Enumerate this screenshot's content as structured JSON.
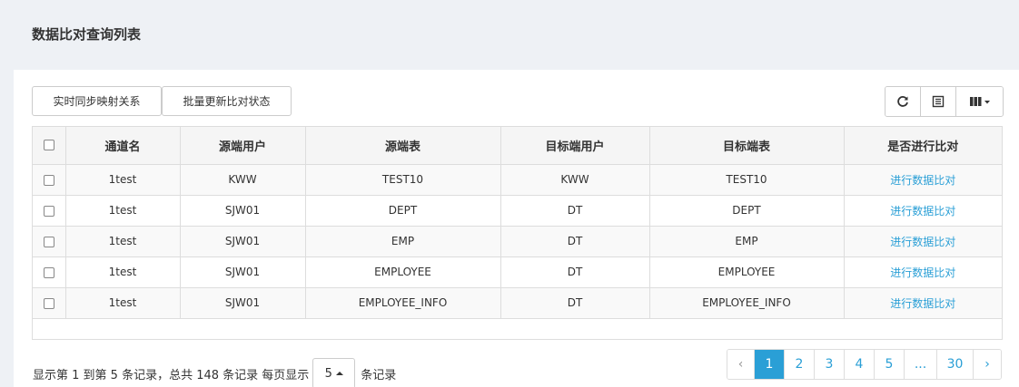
{
  "page": {
    "title": "数据比对查询列表"
  },
  "toolbar": {
    "sync_label": "实时同步映射关系",
    "batch_label": "批量更新比对状态",
    "refresh_icon": "refresh-icon",
    "list_icon": "list-icon",
    "columns_icon": "columns-icon"
  },
  "table": {
    "headers": [
      "通道名",
      "源端用户",
      "源端表",
      "目标端用户",
      "目标端表",
      "是否进行比对"
    ],
    "rows": [
      {
        "channel": "1test",
        "src_user": "KWW",
        "src_table": "TEST10",
        "dst_user": "KWW",
        "dst_table": "TEST10",
        "action": "进行数据比对"
      },
      {
        "channel": "1test",
        "src_user": "SJW01",
        "src_table": "DEPT",
        "dst_user": "DT",
        "dst_table": "DEPT",
        "action": "进行数据比对"
      },
      {
        "channel": "1test",
        "src_user": "SJW01",
        "src_table": "EMP",
        "dst_user": "DT",
        "dst_table": "EMP",
        "action": "进行数据比对"
      },
      {
        "channel": "1test",
        "src_user": "SJW01",
        "src_table": "EMPLOYEE",
        "dst_user": "DT",
        "dst_table": "EMPLOYEE",
        "action": "进行数据比对"
      },
      {
        "channel": "1test",
        "src_user": "SJW01",
        "src_table": "EMPLOYEE_INFO",
        "dst_user": "DT",
        "dst_table": "EMPLOYEE_INFO",
        "action": "进行数据比对"
      }
    ]
  },
  "footer": {
    "info_prefix": "显示第 1 到第 5 条记录，总共 148 条记录 每页显示",
    "page_size": "5",
    "info_suffix": "条记录"
  },
  "pagination": {
    "prev": "‹",
    "pages": [
      "1",
      "2",
      "3",
      "4",
      "5",
      "...",
      "30"
    ],
    "next": "›",
    "active": "1"
  },
  "colors": {
    "accent": "#2a9fd6"
  }
}
